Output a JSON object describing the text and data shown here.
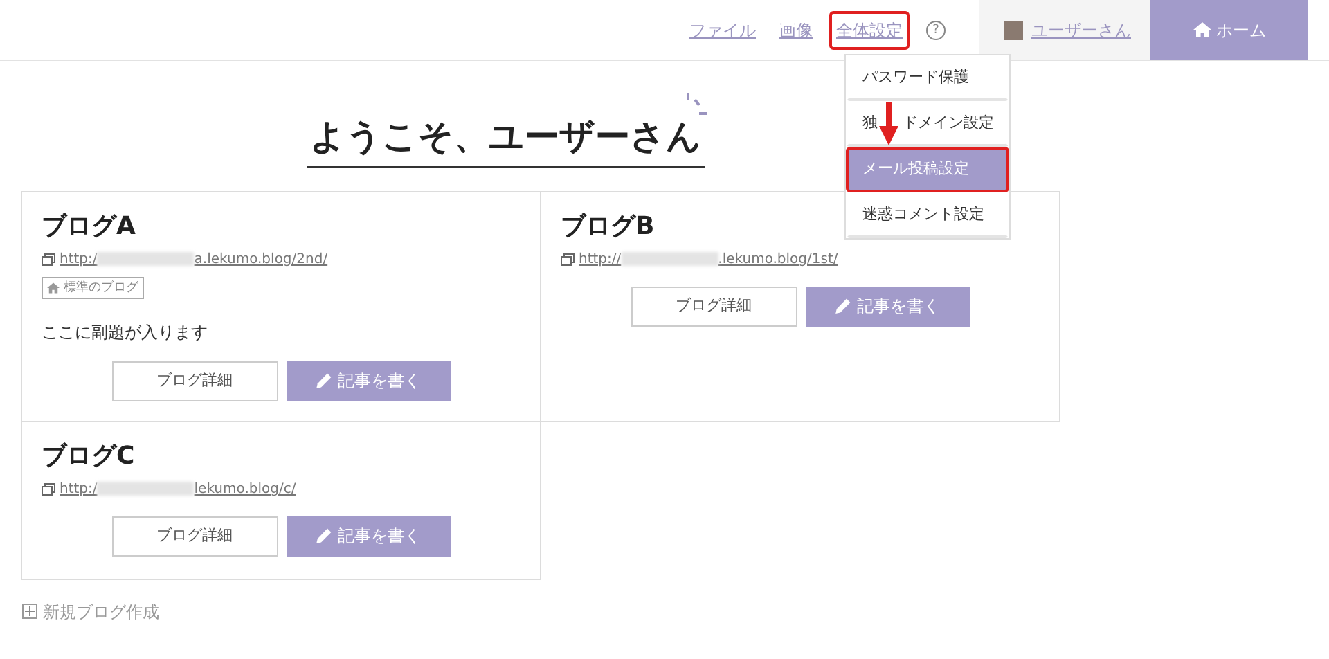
{
  "nav": {
    "links": [
      {
        "label": "ファイル",
        "highlighted": false
      },
      {
        "label": "画像",
        "highlighted": false
      },
      {
        "label": "全体設定",
        "highlighted": true
      }
    ],
    "help": "?",
    "user": "ユーザーさん",
    "home": "ホーム"
  },
  "settings_menu": {
    "items": [
      {
        "label": "パスワード保護",
        "selected": false,
        "highlighted": false
      },
      {
        "label": "独 ドメイン設定",
        "selected": false,
        "highlighted": false
      },
      {
        "label": "メール投稿設定",
        "selected": true,
        "highlighted": true
      },
      {
        "label": "迷惑コメント設定",
        "selected": false,
        "highlighted": false
      }
    ]
  },
  "heading": "ようこそ、ユーザーさん",
  "blogs": [
    {
      "title": "ブログA",
      "url_start": "http:/",
      "url_end": "a.lekumo.blog/2nd/",
      "tag": "標準のブログ",
      "subtitle": "ここに副題が入ります",
      "detail_button": "ブログ詳細",
      "write_button": "記事を書く"
    },
    {
      "title": "ブログB",
      "url_start": "http://",
      "url_end": ".lekumo.blog/1st/",
      "detail_button": "ブログ詳細",
      "write_button": "記事を書く"
    },
    {
      "title": "ブログC",
      "url_start": "http:/",
      "url_end": "lekumo.blog/c/",
      "detail_button": "ブログ詳細",
      "write_button": "記事を書く"
    }
  ],
  "new_blog": "新規ブログ作成"
}
